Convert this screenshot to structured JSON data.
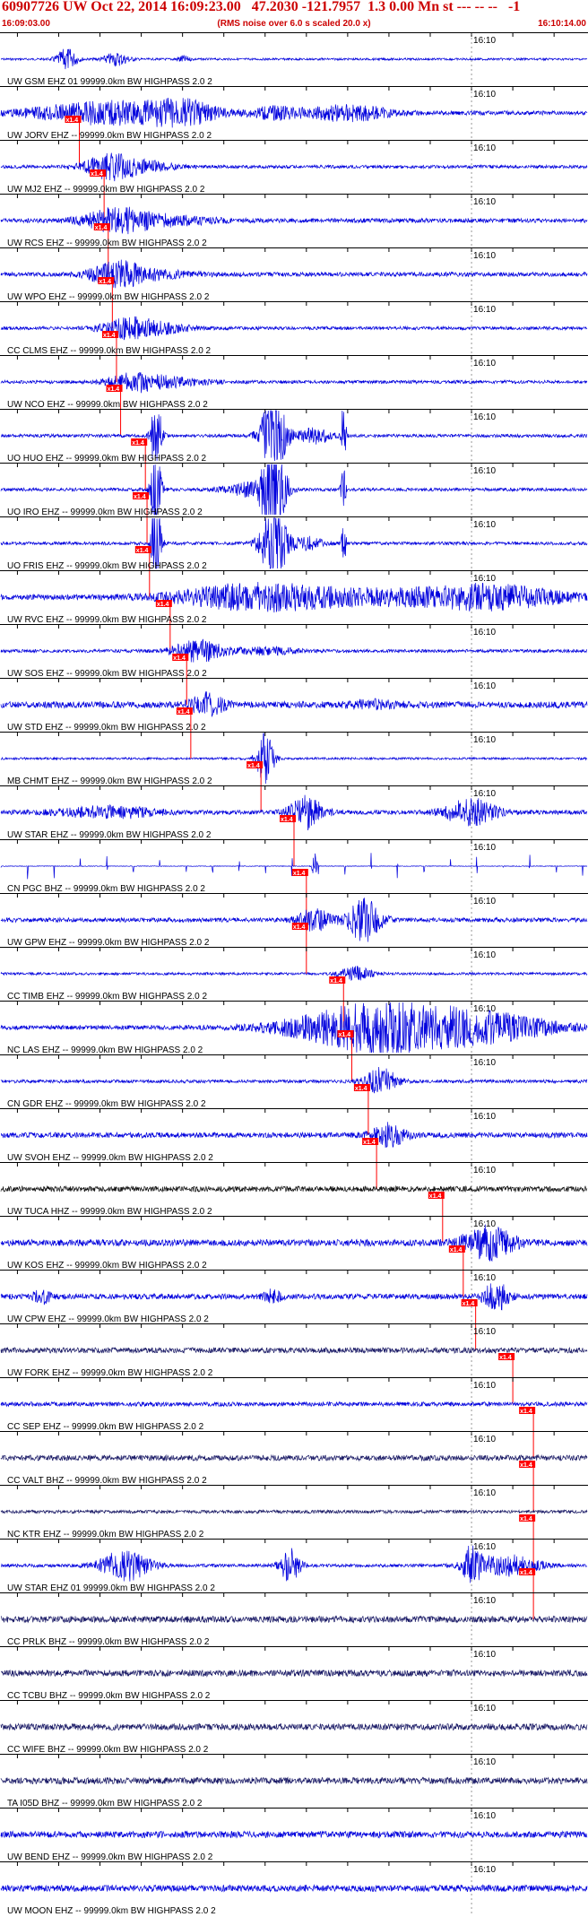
{
  "header": {
    "title": "60907726 UW Oct 22, 2014 16:09:23.00   47.2030 -121.7957  1.3 0.00 Mn st --- -- --   -1",
    "subtitle": "(RMS noise over 6.0 s scaled 20.0 x)",
    "start_time": "16:09:03.00",
    "end_time": "16:10:14.00"
  },
  "colors": {
    "trace": "#0000dd",
    "trace_black": "#111111",
    "trace_dark": "#1a1a66",
    "pick": "#ff0000",
    "header": "#cc0000",
    "grid": "#000000"
  },
  "chart_data": {
    "type": "line",
    "title": "60907726 UW Oct 22, 2014 16:09:23.00   47.2030 -121.7957  1.3 0.00 Mn st --- -- --   -1",
    "subtitle": "(RMS noise over 6.0 s scaled 20.0 x)",
    "x_range": [
      "16:09:03.00",
      "16:10:14.00"
    ],
    "minute_mark_label": "16:10",
    "grid": "vertical ticks every 5 s",
    "pick_label": "x1.4",
    "channels": [
      {
        "label": "UW GSM EHZ 01 99999.0km BW  HIGHPASS  2.0  2",
        "pick_s": null,
        "bursts": [
          [
            8,
            1.2,
            1
          ],
          [
            14,
            1.5,
            0.6
          ],
          [
            22,
            0.8,
            0.3
          ]
        ],
        "noise": 0.1,
        "color": "trace"
      },
      {
        "label": "UW JORV EHZ -- 99999.0km BW  HIGHPASS  2.0  2",
        "pick_s": 9.5,
        "bursts": [
          [
            13,
            9,
            1
          ],
          [
            22,
            4,
            0.9
          ],
          [
            42,
            5,
            0.7
          ],
          [
            33,
            3,
            0.5
          ]
        ],
        "noise": 0.2,
        "color": "trace"
      },
      {
        "label": "UW MJ2 EHZ -- 99999.0km BW  HIGHPASS  2.0  2",
        "pick_s": 12.5,
        "bursts": [
          [
            13,
            3,
            1
          ],
          [
            17,
            4,
            0.5
          ]
        ],
        "noise": 0.15,
        "color": "trace"
      },
      {
        "label": "UW RCS EHZ -- 99999.0km BW  HIGHPASS  2.0  2",
        "pick_s": 13.0,
        "bursts": [
          [
            14,
            4,
            1
          ],
          [
            20,
            6,
            0.4
          ]
        ],
        "noise": 0.2,
        "color": "trace"
      },
      {
        "label": "UW WPO EHZ -- 99999.0km BW  HIGHPASS  2.0  2",
        "pick_s": 13.5,
        "bursts": [
          [
            14,
            3,
            1
          ],
          [
            18,
            5,
            0.4
          ]
        ],
        "noise": 0.2,
        "color": "trace"
      },
      {
        "label": "CC CLMS EHZ -- 99999.0km BW  HIGHPASS  2.0  2",
        "pick_s": 14.0,
        "bursts": [
          [
            15,
            3,
            0.8
          ],
          [
            19,
            4,
            0.5
          ]
        ],
        "noise": 0.15,
        "color": "trace"
      },
      {
        "label": "UW NCO EHZ -- 99999.0km BW  HIGHPASS  2.0  2",
        "pick_s": 14.5,
        "bursts": [
          [
            16,
            3,
            0.7
          ],
          [
            20,
            5,
            0.4
          ]
        ],
        "noise": 0.15,
        "color": "trace"
      },
      {
        "label": "UO HUO EHZ -- 99999.0km BW  HIGHPASS  2.0  2",
        "pick_s": 17.5,
        "bursts": [
          [
            18.8,
            0.6,
            4
          ],
          [
            33,
            1.5,
            4
          ],
          [
            38,
            2,
            0.7
          ],
          [
            41.5,
            0.3,
            3
          ]
        ],
        "noise": 0.15,
        "color": "trace"
      },
      {
        "label": "UO IRO EHZ -- 99999.0km BW  HIGHPASS  2.0  2",
        "pick_s": 17.7,
        "bursts": [
          [
            18.8,
            0.6,
            4
          ],
          [
            30,
            3,
            0.6
          ],
          [
            33,
            1.5,
            4
          ],
          [
            41.5,
            0.3,
            2
          ]
        ],
        "noise": 0.15,
        "color": "trace"
      },
      {
        "label": "UO FRIS EHZ -- 99999.0km BW  HIGHPASS  2.0  2",
        "pick_s": 18.0,
        "bursts": [
          [
            18.8,
            0.6,
            4
          ],
          [
            33,
            1.5,
            4
          ],
          [
            37,
            2,
            0.6
          ],
          [
            41.5,
            0.3,
            2
          ]
        ],
        "noise": 0.15,
        "color": "trace"
      },
      {
        "label": "UW RVC EHZ -- 99999.0km BW  HIGHPASS  2.0  2",
        "pick_s": 20.5,
        "bursts": [
          [
            30,
            9,
            1
          ],
          [
            45,
            14,
            0.6
          ],
          [
            60,
            8,
            0.9
          ]
        ],
        "noise": 0.25,
        "color": "trace"
      },
      {
        "label": "UW SOS EHZ -- 99999.0km BW  HIGHPASS  2.0  2",
        "pick_s": 22.5,
        "bursts": [
          [
            24,
            3,
            1
          ],
          [
            32,
            4,
            0.3
          ]
        ],
        "noise": 0.15,
        "color": "trace"
      },
      {
        "label": "UW STD EHZ -- 99999.0km BW  HIGHPASS  2.0  2",
        "pick_s": 23.0,
        "bursts": [
          [
            25,
            2,
            1
          ],
          [
            45,
            3,
            0.3
          ]
        ],
        "noise": 0.3,
        "color": "trace"
      },
      {
        "label": "MB CHMT EHZ -- 99999.0km BW  HIGHPASS  2.0  2",
        "pick_s": 31.5,
        "bursts": [
          [
            32,
            1,
            2.5
          ]
        ],
        "noise": 0.1,
        "color": "trace"
      },
      {
        "label": "UW STAR EHZ -- 99999.0km BW  HIGHPASS  2.0  2",
        "pick_s": 35.5,
        "bursts": [
          [
            37,
            2,
            1.5
          ],
          [
            57,
            3,
            1.3
          ],
          [
            13,
            6,
            0.5
          ]
        ],
        "noise": 0.2,
        "color": "trace"
      },
      {
        "label": "CN PGC BHZ -- 99999.0km BW  HIGHPASS  2.0  2",
        "pick_s": 37.0,
        "bursts": [
          [
            38,
            0.3,
            1.2
          ]
        ],
        "noise": 0.03,
        "color": "trace",
        "spikes": true
      },
      {
        "label": "UW GPW EHZ -- 99999.0km BW  HIGHPASS  2.0  2",
        "pick_s": 37.0,
        "bursts": [
          [
            38,
            2,
            1
          ],
          [
            44,
            2,
            2
          ]
        ],
        "noise": 0.2,
        "color": "trace"
      },
      {
        "label": "CC TIMB EHZ -- 99999.0km BW  HIGHPASS  2.0  2",
        "pick_s": 41.5,
        "bursts": [
          [
            43,
            2,
            0.6
          ]
        ],
        "noise": 0.12,
        "color": "trace"
      },
      {
        "label": "NC LAS EHZ -- 99999.0km BW  HIGHPASS  2.0  2",
        "pick_s": 42.5,
        "bursts": [
          [
            46,
            10,
            2.5
          ],
          [
            60,
            8,
            1
          ]
        ],
        "noise": 0.2,
        "color": "trace"
      },
      {
        "label": "CN GDR EHZ -- 99999.0km BW  HIGHPASS  2.0  2",
        "pick_s": 44.5,
        "bursts": [
          [
            46,
            2,
            1.2
          ]
        ],
        "noise": 0.15,
        "color": "trace"
      },
      {
        "label": "UW SVOH EHZ -- 99999.0km BW  HIGHPASS  2.0  2",
        "pick_s": 45.5,
        "bursts": [
          [
            47,
            2,
            1
          ]
        ],
        "noise": 0.25,
        "color": "trace"
      },
      {
        "label": "UW TUCA HHZ -- 99999.0km BW  HIGHPASS  2.0  2",
        "pick_s": 53.5,
        "bursts": [],
        "noise": 0.25,
        "color": "trace_black"
      },
      {
        "label": "UW KOS EHZ -- 99999.0km BW  HIGHPASS  2.0  2",
        "pick_s": 56.0,
        "bursts": [
          [
            59,
            3,
            1.5
          ]
        ],
        "noise": 0.3,
        "color": "trace"
      },
      {
        "label": "UW CPW EHZ -- 99999.0km BW  HIGHPASS  2.0  2",
        "pick_s": 57.5,
        "bursts": [
          [
            5,
            1,
            0.6
          ],
          [
            33,
            1,
            0.6
          ],
          [
            60,
            1.5,
            1.3
          ]
        ],
        "noise": 0.25,
        "color": "trace"
      },
      {
        "label": "UW FORK EHZ -- 99999.0km BW  HIGHPASS  2.0  2",
        "pick_s": 62.0,
        "bursts": [],
        "noise": 0.25,
        "color": "trace_dark"
      },
      {
        "label": "CC SEP EHZ -- 99999.0km BW  HIGHPASS  2.0  2",
        "pick_s": 64.5,
        "bursts": [],
        "noise": 0.2,
        "color": "trace"
      },
      {
        "label": "CC VALT BHZ -- 99999.0km BW  HIGHPASS  2.0  2",
        "pick_s": 64.5,
        "bursts": [],
        "noise": 0.25,
        "color": "trace_dark"
      },
      {
        "label": "NC KTR EHZ -- 99999.0km BW  HIGHPASS  2.0  2",
        "pick_s": 64.5,
        "bursts": [],
        "noise": 0.15,
        "color": "trace_dark"
      },
      {
        "label": "UW STAR EHZ 01 99999.0km BW  HIGHPASS  2.0  2",
        "pick_s": 64.5,
        "bursts": [
          [
            15,
            3,
            1.4
          ],
          [
            35,
            1.2,
            1.6
          ],
          [
            57,
            1,
            1.8
          ],
          [
            61,
            4,
            1
          ]
        ],
        "noise": 0.15,
        "color": "trace"
      },
      {
        "label": "CC PRLK BHZ -- 99999.0km BW  HIGHPASS  2.0  2",
        "pick_s": null,
        "bursts": [],
        "noise": 0.3,
        "color": "trace_dark"
      },
      {
        "label": "CC TCBU BHZ -- 99999.0km BW  HIGHPASS  2.0  2",
        "pick_s": null,
        "bursts": [],
        "noise": 0.3,
        "color": "trace_dark"
      },
      {
        "label": "CC WIFE BHZ -- 99999.0km BW  HIGHPASS  2.0  2",
        "pick_s": null,
        "bursts": [],
        "noise": 0.3,
        "color": "trace_dark"
      },
      {
        "label": "TA I05D BHZ -- 99999.0km BW  HIGHPASS  2.0  2",
        "pick_s": null,
        "bursts": [],
        "noise": 0.3,
        "color": "trace_dark"
      },
      {
        "label": "UW BEND EHZ -- 99999.0km BW  HIGHPASS  2.0  2",
        "pick_s": null,
        "bursts": [],
        "noise": 0.3,
        "color": "trace"
      },
      {
        "label": "UW MOON EHZ -- 99999.0km BW  HIGHPASS  2.0  2",
        "pick_s": null,
        "bursts": [],
        "noise": 0.3,
        "color": "trace"
      }
    ]
  }
}
